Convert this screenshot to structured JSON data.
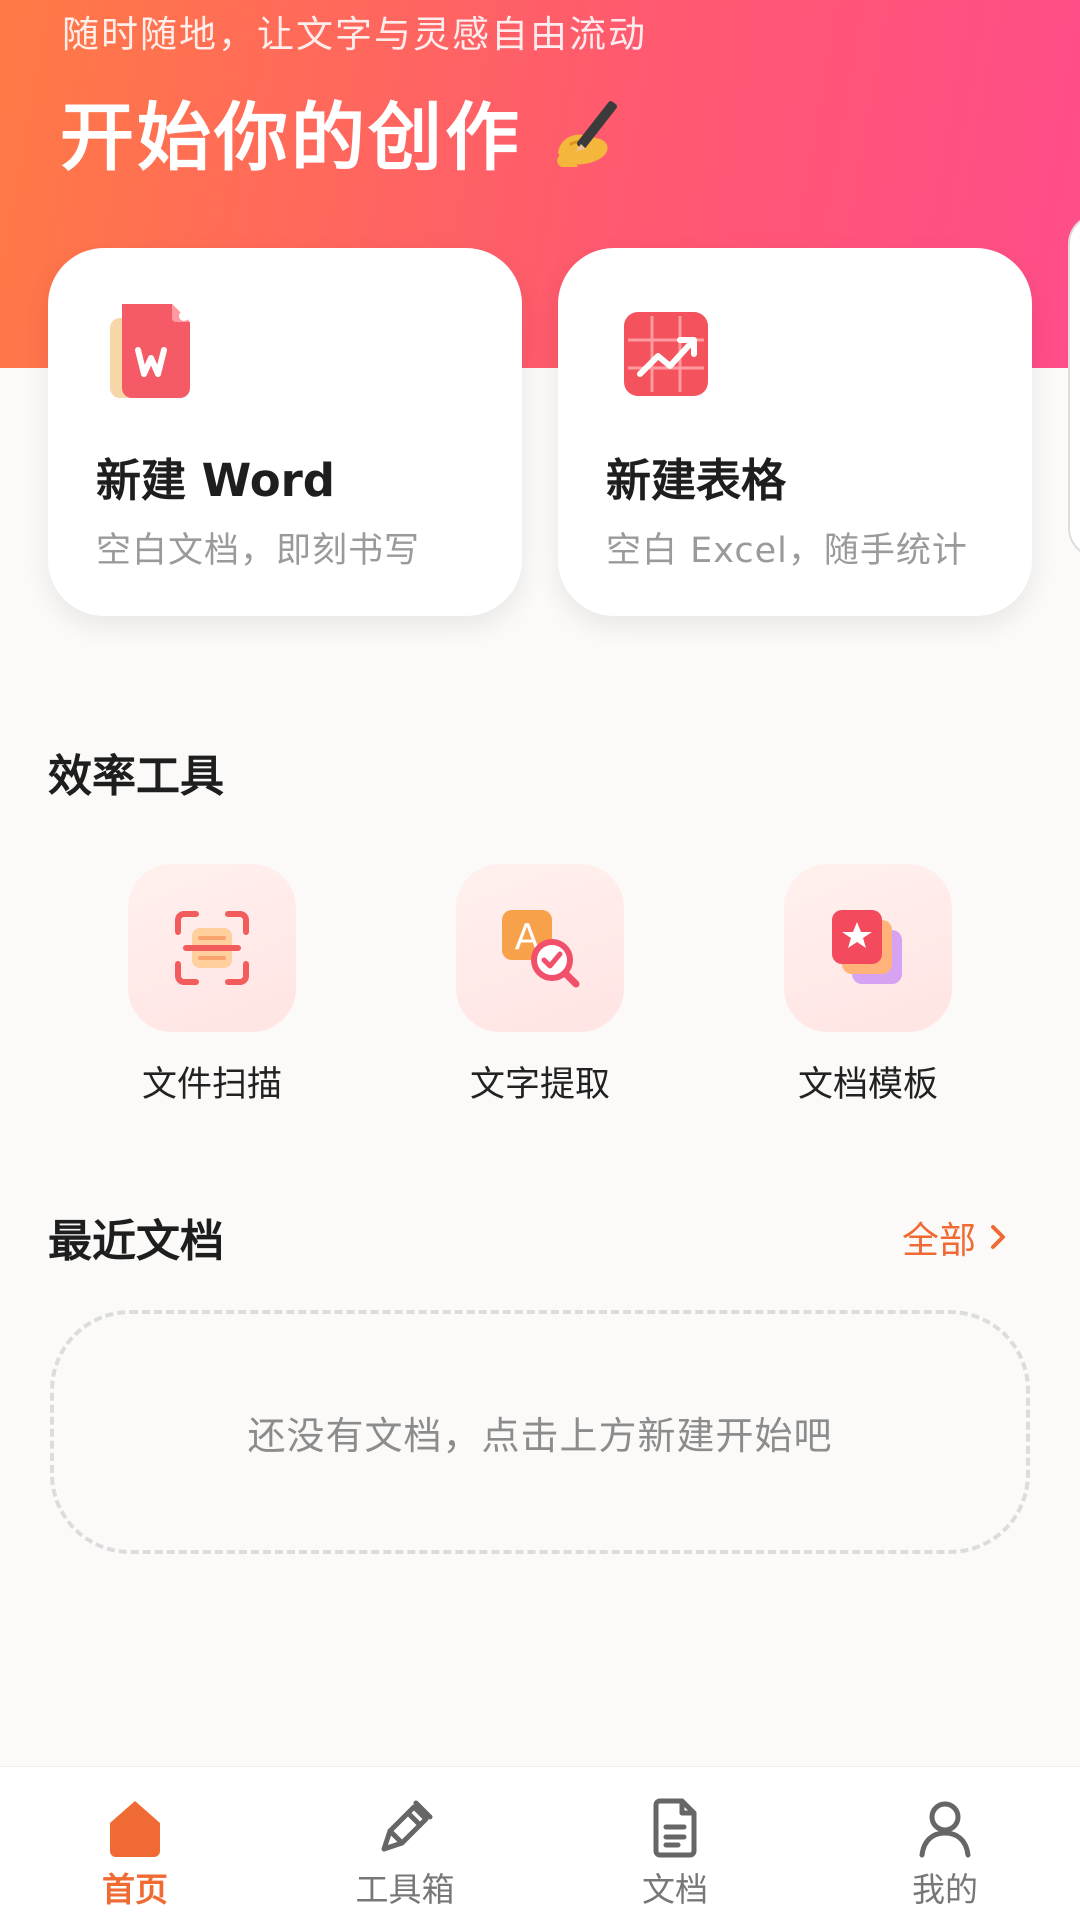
{
  "hero": {
    "tagline": "随时随地，让文字与灵感自由流动",
    "title": "开始你的创作",
    "emoji_icon": "writing-hand-icon"
  },
  "create_cards": [
    {
      "title": "新建 Word",
      "subtitle": "空白文档，即刻书写",
      "icon": "word-file-icon"
    },
    {
      "title": "新建表格",
      "subtitle": "空白 Excel，随手统计",
      "icon": "spreadsheet-chart-icon"
    }
  ],
  "tools_section": {
    "title": "效率工具",
    "items": [
      {
        "label": "文件扫描",
        "icon": "scan-icon"
      },
      {
        "label": "文字提取",
        "icon": "text-extract-icon"
      },
      {
        "label": "文档模板",
        "icon": "template-icon"
      }
    ]
  },
  "recent_section": {
    "title": "最近文档",
    "see_all": "全部",
    "empty_text": "还没有文档，点击上方新建开始吧"
  },
  "bottom_nav": [
    {
      "label": "首页",
      "icon": "home-icon",
      "active": true
    },
    {
      "label": "工具箱",
      "icon": "pen-tool-icon",
      "active": false
    },
    {
      "label": "文档",
      "icon": "document-icon",
      "active": false
    },
    {
      "label": "我的",
      "icon": "user-icon",
      "active": false
    }
  ],
  "colors": {
    "accent": "#f06a33",
    "hero_start": "#ff7a45",
    "hero_end": "#ff4d8a",
    "background": "#fcfaf8"
  }
}
